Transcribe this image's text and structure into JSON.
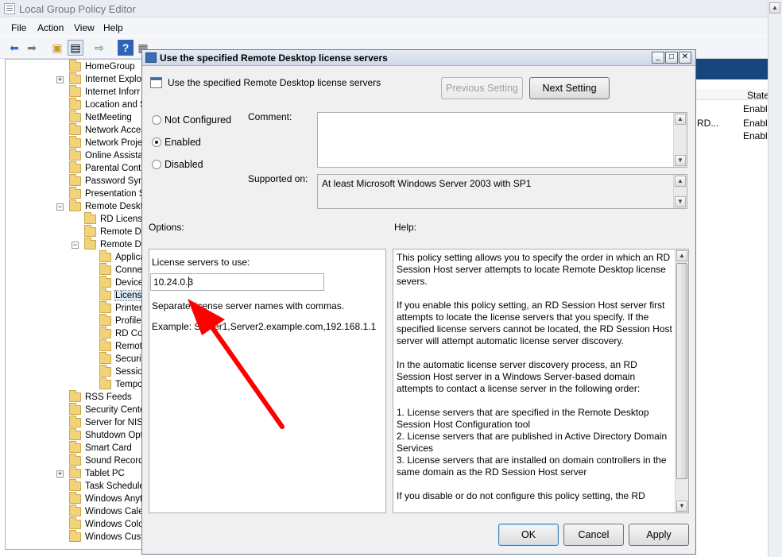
{
  "main_window": {
    "title": "Local Group Policy Editor",
    "menu": [
      "File",
      "Action",
      "View",
      "Help"
    ],
    "toolbar_icons": [
      "back-arrow-icon",
      "forward-arrow-icon",
      "up-folder-icon",
      "show-hide-tree-icon",
      "export-list-icon",
      "help-icon",
      "properties-icon",
      "filter-icon"
    ]
  },
  "tree": {
    "items": [
      {
        "label": "HomeGroup",
        "indent": 0,
        "expander": ""
      },
      {
        "label": "Internet Explor",
        "indent": 0,
        "expander": "+"
      },
      {
        "label": "Internet Inforr",
        "indent": 0,
        "expander": ""
      },
      {
        "label": "Location and S",
        "indent": 0,
        "expander": ""
      },
      {
        "label": "NetMeeting",
        "indent": 0,
        "expander": ""
      },
      {
        "label": "Network Acces",
        "indent": 0,
        "expander": ""
      },
      {
        "label": "Network Projec",
        "indent": 0,
        "expander": ""
      },
      {
        "label": "Online Assistar",
        "indent": 0,
        "expander": ""
      },
      {
        "label": "Parental Contr",
        "indent": 0,
        "expander": ""
      },
      {
        "label": "Password Sync",
        "indent": 0,
        "expander": ""
      },
      {
        "label": "Presentation S",
        "indent": 0,
        "expander": ""
      },
      {
        "label": "Remote Deskto",
        "indent": 0,
        "expander": "−"
      },
      {
        "label": "RD Licensin",
        "indent": 1,
        "expander": ""
      },
      {
        "label": "Remote De",
        "indent": 1,
        "expander": ""
      },
      {
        "label": "Remote De",
        "indent": 1,
        "expander": "−"
      },
      {
        "label": "Applica",
        "indent": 2,
        "expander": ""
      },
      {
        "label": "Conne",
        "indent": 2,
        "expander": ""
      },
      {
        "label": "Device",
        "indent": 2,
        "expander": ""
      },
      {
        "label": "Licensi",
        "indent": 2,
        "expander": "",
        "selected": true
      },
      {
        "label": "Printer",
        "indent": 2,
        "expander": ""
      },
      {
        "label": "Profiles",
        "indent": 2,
        "expander": ""
      },
      {
        "label": "RD Cor",
        "indent": 2,
        "expander": ""
      },
      {
        "label": "Remote",
        "indent": 2,
        "expander": ""
      },
      {
        "label": "Securit",
        "indent": 2,
        "expander": ""
      },
      {
        "label": "Session",
        "indent": 2,
        "expander": ""
      },
      {
        "label": "Tempo",
        "indent": 2,
        "expander": ""
      },
      {
        "label": "RSS Feeds",
        "indent": 0,
        "expander": ""
      },
      {
        "label": "Security Cente",
        "indent": 0,
        "expander": ""
      },
      {
        "label": "Server for NIS",
        "indent": 0,
        "expander": ""
      },
      {
        "label": "Shutdown Opti",
        "indent": 0,
        "expander": ""
      },
      {
        "label": "Smart Card",
        "indent": 0,
        "expander": ""
      },
      {
        "label": "Sound Recorde",
        "indent": 0,
        "expander": ""
      },
      {
        "label": "Tablet PC",
        "indent": 0,
        "expander": "+"
      },
      {
        "label": "Task Scheduler",
        "indent": 0,
        "expander": ""
      },
      {
        "label": "Windows Anyti",
        "indent": 0,
        "expander": ""
      },
      {
        "label": "Windows Caler",
        "indent": 0,
        "expander": ""
      },
      {
        "label": "Windows Color",
        "indent": 0,
        "expander": ""
      },
      {
        "label": "Windows Custo",
        "indent": 0,
        "expander": ""
      }
    ]
  },
  "right_panel": {
    "state_header": "State",
    "partial_cell": "RD...",
    "states": [
      "Enable",
      "Enable",
      "Enable"
    ]
  },
  "dialog": {
    "title": "Use the specified Remote Desktop license servers",
    "setting_name": "Use the specified Remote Desktop license servers",
    "prev_button": "Previous Setting",
    "next_button": "Next Setting",
    "radios": {
      "not_configured": "Not Configured",
      "enabled": "Enabled",
      "disabled": "Disabled"
    },
    "selected_radio": "enabled",
    "comment_label": "Comment:",
    "comment_value": "",
    "supported_label": "Supported on:",
    "supported_value": "At least Microsoft Windows Server 2003 with SP1",
    "options_label": "Options:",
    "help_label": "Help:",
    "options": {
      "servers_label": "License servers to use:",
      "servers_value": "10.24.0.3",
      "separator_hint": "Separate license server names with commas.",
      "example": "Example: Server1,Server2.example.com,192.168.1.1"
    },
    "help_paragraphs": [
      "This policy setting allows you to specify the order in which an RD Session Host server attempts to locate Remote Desktop license severs.",
      "If you enable this policy setting, an RD Session Host server first attempts to locate the license servers that you specify. If the specified license servers cannot be located, the RD Session Host server will attempt automatic license server discovery.",
      "In the automatic license server discovery process, an RD Session Host server in a Windows Server-based domain attempts to contact a license server in the following order:",
      "1. License servers that are specified in the Remote Desktop Session Host Configuration tool\n2. License servers that are published in Active Directory Domain Services\n3. License servers that are installed on domain controllers in the same domain as the RD Session Host server",
      "If you disable or do not configure this policy setting, the RD"
    ],
    "ok_button": "OK",
    "cancel_button": "Cancel",
    "apply_button": "Apply",
    "annotation_arrow_color": "#ff0000"
  }
}
